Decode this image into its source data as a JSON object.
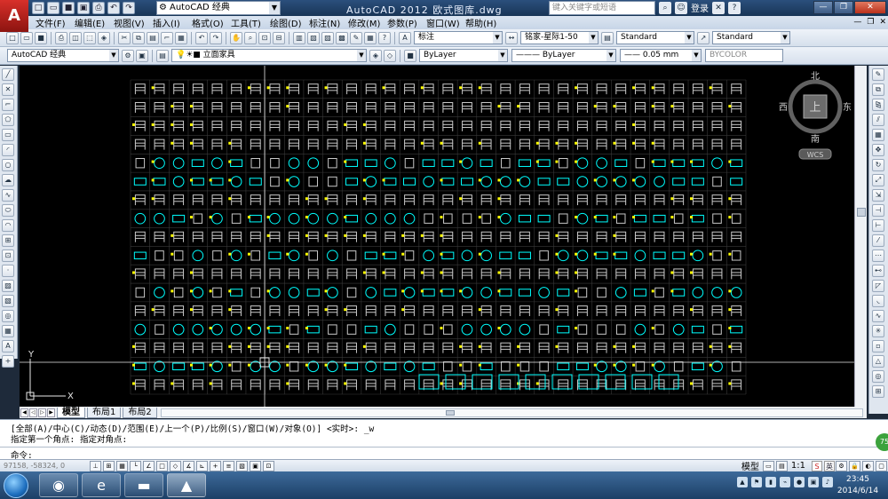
{
  "titlebar": {
    "app_logo": "A",
    "workspace": "AutoCAD 经典",
    "title": "AutoCAD 2012    欧式图库.dwg",
    "search_placeholder": "键入关键字或短语",
    "login": "登录"
  },
  "menu": [
    "文件(F)",
    "编辑(E)",
    "视图(V)",
    "插入(I)",
    "格式(O)",
    "工具(T)",
    "绘图(D)",
    "标注(N)",
    "修改(M)",
    "参数(P)",
    "窗口(W)",
    "帮助(H)"
  ],
  "toolbar1": {
    "dimstyle": "标注",
    "textstyle": "铭家-星际1-50",
    "tablestyle": "Standard",
    "mleaderstyle": "Standard"
  },
  "toolbar2": {
    "workspace": "AutoCAD 经典",
    "layer": "立面家具",
    "color": "ByLayer",
    "linetype": "ByLayer",
    "lineweight": "0.05 mm",
    "plotstyle": "BYCOLOR"
  },
  "viewcube": {
    "north": "北",
    "south": "南",
    "east": "东",
    "west": "西",
    "face": "上",
    "wcs": "WCS"
  },
  "ucs": {
    "x": "X",
    "y": "Y"
  },
  "layout_tabs": [
    "模型",
    "布局1",
    "布局2"
  ],
  "command": {
    "line1": "[全部(A)/中心(C)/动态(D)/范围(E)/上一个(P)/比例(S)/窗口(W)/对象(O)] <实时>: _w",
    "line2": "指定第一个角点: 指定对角点:",
    "prompt": "命令:"
  },
  "status": {
    "coords": "97158, -58324, 0",
    "model": "模型",
    "scale": "1:1"
  },
  "ime": [
    "S",
    "英"
  ],
  "clock": {
    "time": "23:45",
    "date": "2014/6/14"
  },
  "badge": "75",
  "colors": {
    "cyan": "#00ffff",
    "gray": "#c8c8c8",
    "yellow": "#ffff00",
    "accent": "#2b4f7c"
  }
}
